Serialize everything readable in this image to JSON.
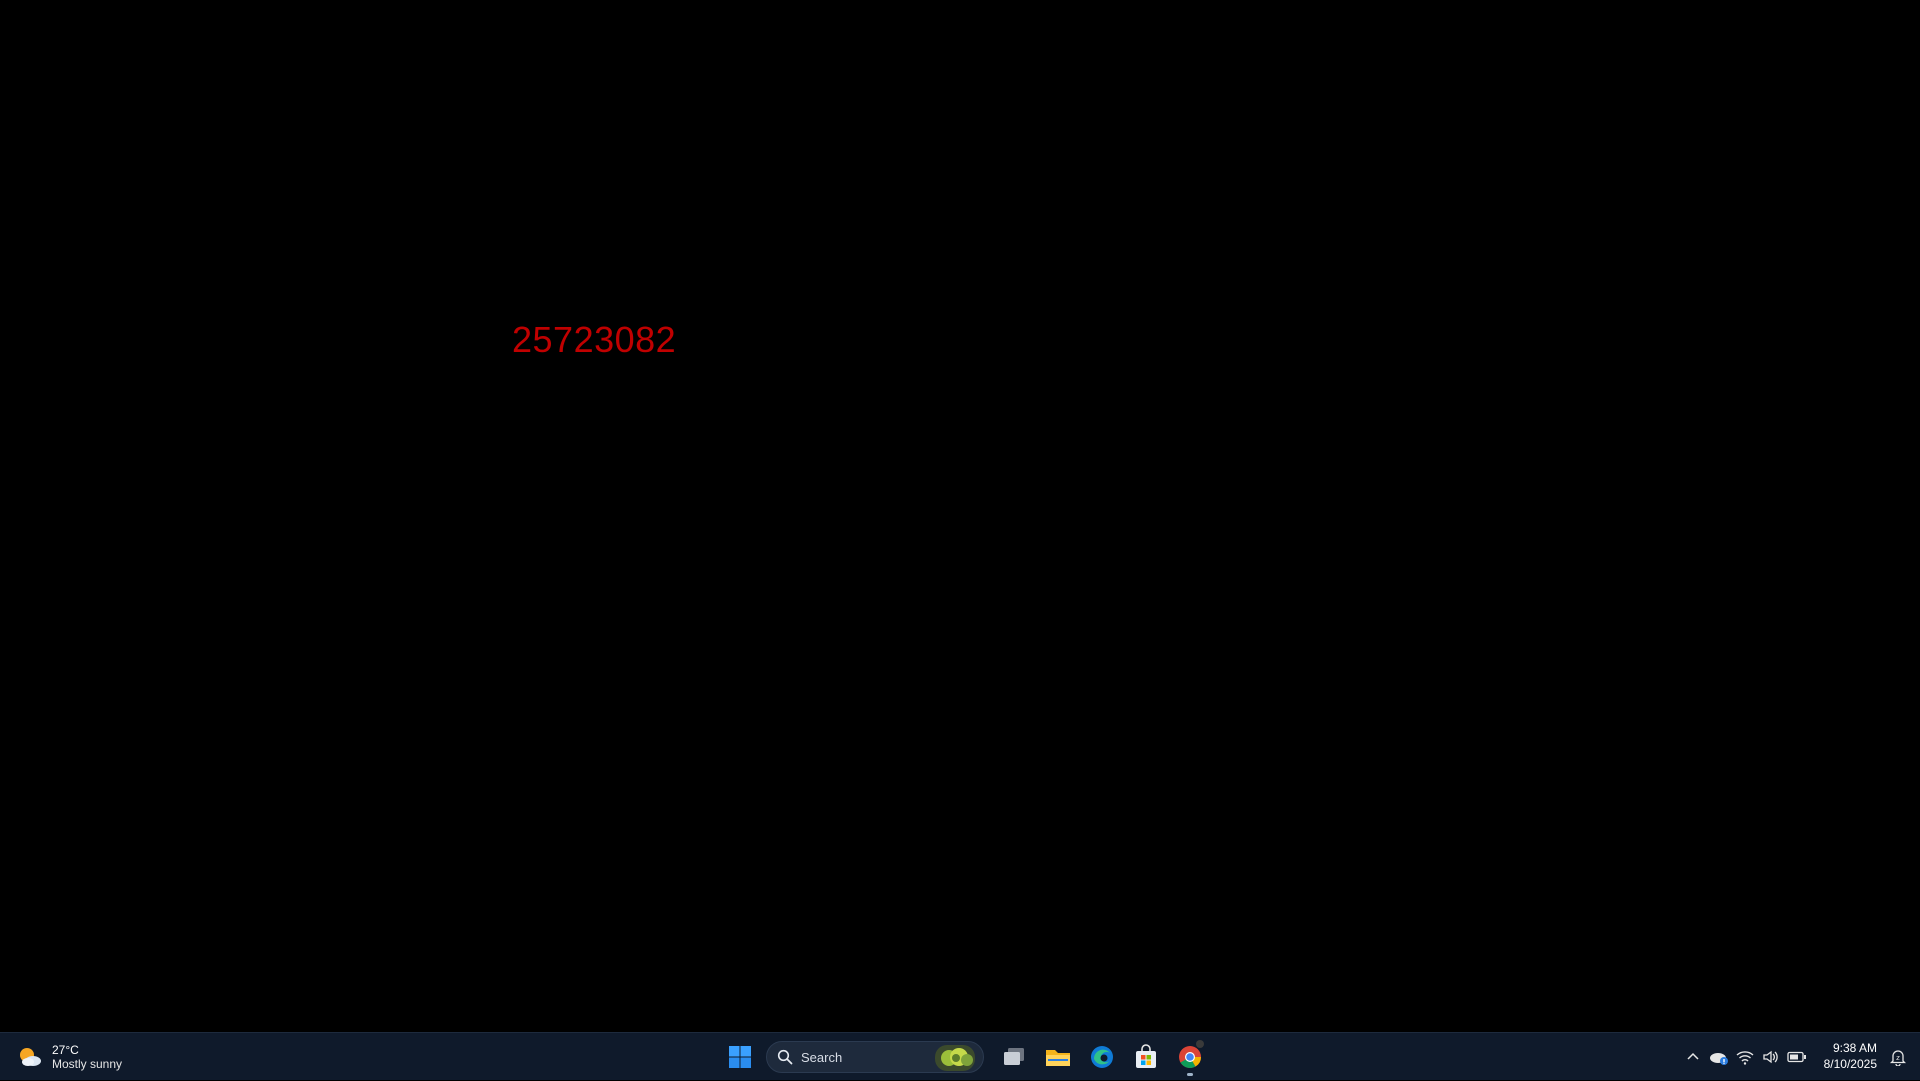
{
  "desktop": {
    "number_text": "25723082",
    "number_color": "#c00000",
    "background": "#000000"
  },
  "taskbar": {
    "background": "#0f1a2b",
    "weather": {
      "temperature": "27°C",
      "condition": "Mostly sunny",
      "icon": "partly-sunny-icon"
    },
    "search": {
      "label": "Search"
    },
    "pinned": [
      {
        "name": "start-button",
        "icon": "windows-logo-icon"
      },
      {
        "name": "task-view",
        "icon": "task-view-icon"
      },
      {
        "name": "file-explorer",
        "icon": "folder-icon"
      },
      {
        "name": "edge",
        "icon": "edge-icon"
      },
      {
        "name": "microsoft-store",
        "icon": "store-icon"
      },
      {
        "name": "chrome",
        "icon": "chrome-icon",
        "running": true
      }
    ],
    "tray": {
      "icons": [
        "chevron-up-icon",
        "onedrive-icon",
        "wifi-icon",
        "volume-icon",
        "battery-icon"
      ],
      "time": "9:38 AM",
      "date": "8/10/2025"
    }
  }
}
